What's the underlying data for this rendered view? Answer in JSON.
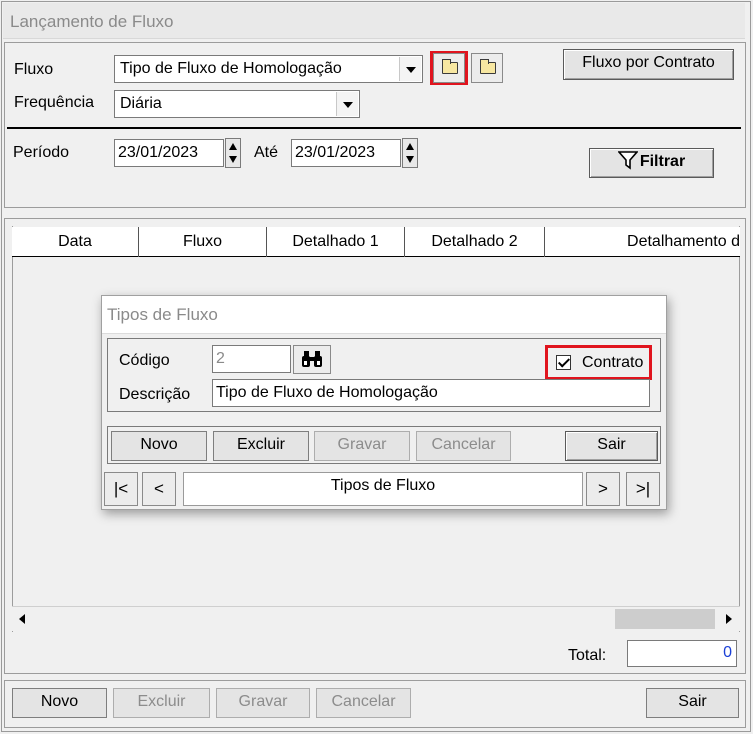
{
  "window": {
    "title": "Lançamento de Fluxo"
  },
  "filters": {
    "fluxo_label": "Fluxo",
    "fluxo_value": "Tipo de Fluxo de Homologação",
    "frequencia_label": "Frequência",
    "frequencia_value": "Diária",
    "fluxo_contrato_button": "Fluxo por Contrato",
    "periodo_label": "Período",
    "periodo_start": "23/01/2023",
    "ate_label": "Até",
    "periodo_end": "23/01/2023",
    "filtrar_button": "Filtrar"
  },
  "grid": {
    "columns": [
      "Data",
      "Fluxo",
      "Detalhado 1",
      "Detalhado 2",
      "Detalhamento d"
    ]
  },
  "total": {
    "label": "Total:",
    "value": "0"
  },
  "footer": {
    "novo": "Novo",
    "excluir": "Excluir",
    "gravar": "Gravar",
    "cancelar": "Cancelar",
    "sair": "Sair"
  },
  "dialog": {
    "title": "Tipos de Fluxo",
    "codigo_label": "Código",
    "codigo_value": "2",
    "descricao_label": "Descrição",
    "descricao_value": "Tipo de Fluxo de Homologação",
    "contrato_label": "Contrato",
    "contrato_checked": true,
    "buttons": {
      "novo": "Novo",
      "excluir": "Excluir",
      "gravar": "Gravar",
      "cancelar": "Cancelar",
      "sair": "Sair"
    },
    "nav": {
      "first": "|<",
      "prev": "<",
      "label": "Tipos de Fluxo",
      "next": ">",
      "last": ">|"
    }
  },
  "icons": [
    "folder-icon",
    "folder-icon",
    "filter-icon",
    "binoculars-icon",
    "checkbox-icon"
  ],
  "colors": {
    "highlight": "#e0141e",
    "total_value": "#1a3fd6"
  }
}
